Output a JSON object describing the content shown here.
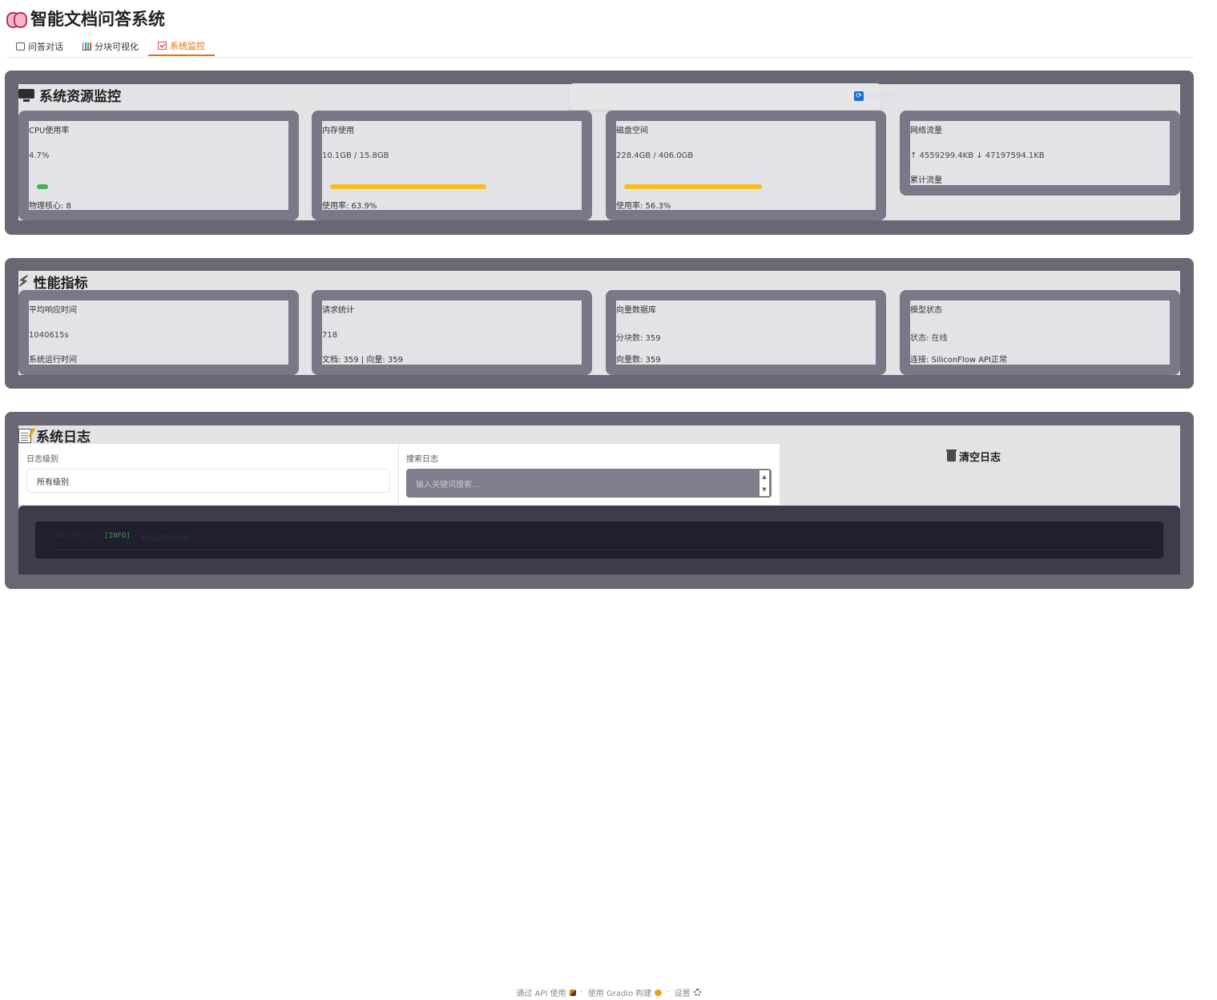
{
  "app": {
    "title": "智能文档问答系统"
  },
  "tabs": [
    {
      "label": "问答对话",
      "icon": "chat-bubble-icon"
    },
    {
      "label": "分块可视化",
      "icon": "bar-chart-icon"
    },
    {
      "label": "系统监控",
      "icon": "checklist-icon",
      "active": true
    }
  ],
  "resources": {
    "title": "系统资源监控",
    "refresh_label": "刷新数据",
    "cards": {
      "cpu": {
        "label": "CPU使用率",
        "value": "4.7%",
        "sub": "物理核心: 8",
        "progress": 0.047,
        "color": "#4caf50"
      },
      "memory": {
        "label": "内存使用",
        "value": "10.1GB / 15.8GB",
        "sub": "使用率: 63.9%",
        "progress": 0.639,
        "color": "#f5bd1f"
      },
      "disk": {
        "label": "磁盘空间",
        "value": "228.4GB / 406.0GB",
        "sub": "使用率: 56.3%",
        "progress": 0.563,
        "color": "#f5bd1f"
      },
      "network": {
        "label": "网络流量",
        "value": "↑ 4559299.4KB ↓ 47197594.1KB",
        "sub": "累计流量"
      }
    }
  },
  "performance": {
    "title": "性能指标",
    "cards": {
      "latency": {
        "label": "平均响应时间",
        "value": "1040615s",
        "sub": "系统运行时间"
      },
      "requests": {
        "label": "请求统计",
        "value": "718",
        "sub": "文档: 359 | 向量: 359"
      },
      "vectordb": {
        "label": "向量数据库",
        "value": "分块数: 359",
        "sub": "向量数: 359"
      },
      "model": {
        "label": "模型状态",
        "value": "状态: 在线",
        "sub": "连接: SiliconFlow API正常"
      }
    }
  },
  "logs": {
    "title": "系统日志",
    "level_label": "日志级别",
    "level_value": "所有级别",
    "search_label": "搜索日志",
    "search_placeholder": "输入关键词搜索...",
    "clear_label": "清空日志",
    "entries": [
      {
        "time": "2024-01-01",
        "level": "[INFO]",
        "message": "系统监控已启动"
      }
    ]
  },
  "footer": {
    "api": "通过 API 使用",
    "built": "使用 Gradio 构建",
    "settings": "设置",
    "sep": "·"
  }
}
